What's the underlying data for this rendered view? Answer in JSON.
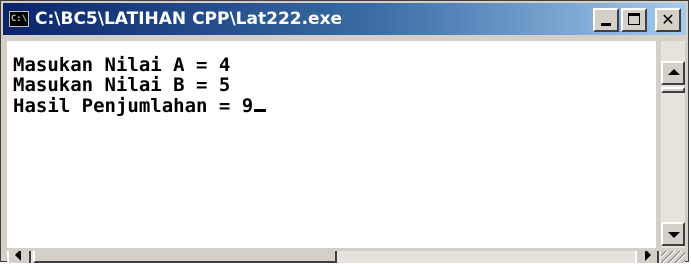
{
  "window": {
    "icon": "console-icon",
    "icon_text": "C:\\",
    "title": "C:\\BC5\\LATIHAN CPP\\Lat222.exe",
    "controls": {
      "minimize": "minimize-icon",
      "maximize": "maximize-icon",
      "close_glyph": "✕"
    }
  },
  "console": {
    "lines": [
      "Masukan Nilai A = 4",
      "Masukan Nilai B = 5",
      "Hasil Penjumlahan = 9"
    ],
    "cursor": "blinking-underscore-cursor"
  },
  "colors": {
    "title_bar_start": "#0a246a",
    "title_bar_end": "#a6caf0",
    "console_bg": "#ffffff",
    "console_text": "#000000",
    "chrome": "#d4d0c8"
  }
}
